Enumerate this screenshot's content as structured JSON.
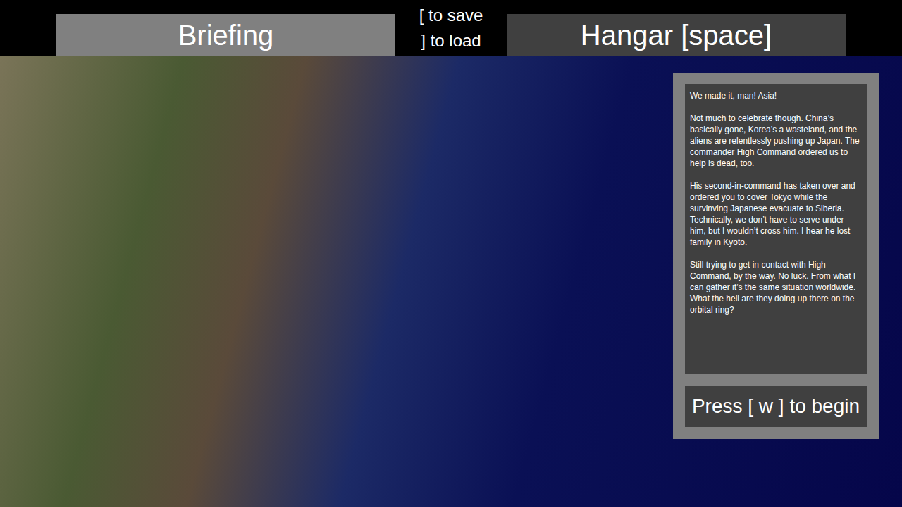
{
  "tabs": [
    {
      "label": "Briefing",
      "selected": true
    },
    {
      "label": "Hangar [space]",
      "selected": false
    }
  ],
  "save_load": [
    "[ to save",
    "] to load"
  ],
  "briefing": {
    "paragraphs": [
      "We made it, man! Asia!",
      "Not much to celebrate though. China’s basically gone, Korea’s a wasteland, and the aliens are relentlessly pushing up Japan. The commander High Command ordered us to help is dead, too.",
      "His second-in-command has taken over and ordered you to cover Tokyo while the survinving Japanese evacuate to Siberia. Technically, we don’t have to serve under him, but I wouldn’t cross him. I hear he lost family in Kyoto.",
      "Still trying to get in contact with High Command, by the way. No luck. From what I can gather it’s the same situation worldwide. What the hell are they doing up there on the orbital ring?"
    ]
  },
  "begin_button": "Press [ w ] to begin"
}
